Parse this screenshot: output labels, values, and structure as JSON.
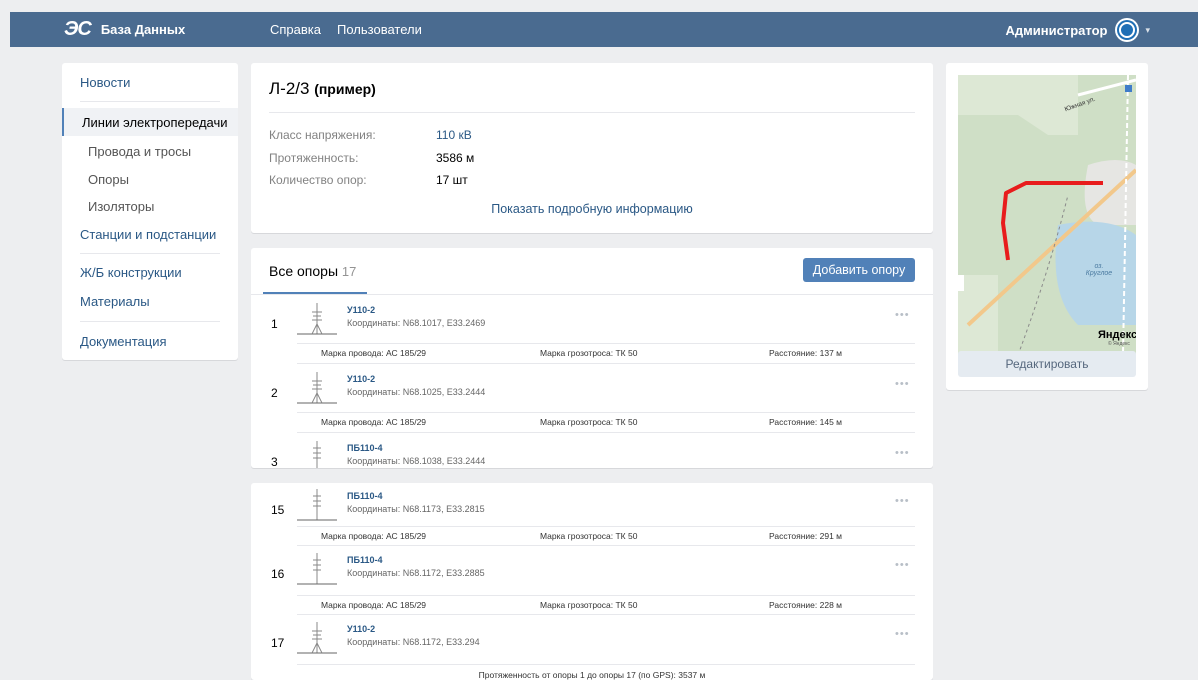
{
  "header": {
    "logo_mark": "ЭС",
    "app_name": "База Данных",
    "nav": [
      "Справка",
      "Пользователи"
    ],
    "user_name": "Администратор"
  },
  "sidebar": {
    "items": [
      {
        "label": "Новости"
      },
      {
        "label": "Линии электропередачи",
        "active": true
      },
      {
        "label": "Провода и тросы"
      },
      {
        "label": "Опоры"
      },
      {
        "label": "Изоляторы"
      },
      {
        "label": "Станции и подстанции"
      },
      {
        "label": "Ж/Б конструкции"
      },
      {
        "label": "Материалы"
      },
      {
        "label": "Документация"
      }
    ]
  },
  "line": {
    "name": "Л-2/3",
    "name_note": "(пример)",
    "props": [
      {
        "label": "Класс напряжения:",
        "value": "110 кВ"
      },
      {
        "label": "Протяженность:",
        "value": "3586 м"
      },
      {
        "label": "Количество опор:",
        "value": "17 шт"
      }
    ],
    "more_link": "Показать подробную информацию"
  },
  "supports": {
    "tab_label": "Все опоры",
    "tab_count": "17",
    "add_button": "Добавить опору",
    "rows": [
      {
        "num": "1",
        "name": "У110-2",
        "coords": "Координаты: N68.1017, E33.2469",
        "wire": "Марка провода: АС 185/29",
        "cable": "Марка грозотроса: ТК 50",
        "distance": "Расстояние: 137 м"
      },
      {
        "num": "2",
        "name": "У110-2",
        "coords": "Координаты: N68.1025, E33.2444",
        "wire": "Марка провода: АС 185/29",
        "cable": "Марка грозотроса: ТК 50",
        "distance": "Расстояние: 145 м"
      },
      {
        "num": "3",
        "name": "ПБ110-4",
        "coords": "Координаты: N68.1038, E33.2444"
      }
    ],
    "rows_end": [
      {
        "num": "15",
        "name": "ПБ110-4",
        "coords": "Координаты: N68.1173, E33.2815",
        "wire": "Марка провода: АС 185/29",
        "cable": "Марка грозотроса: ТК 50",
        "distance": "Расстояние: 291 м"
      },
      {
        "num": "16",
        "name": "ПБ110-4",
        "coords": "Координаты: N68.1172, E33.2885",
        "wire": "Марка провода: АС 185/29",
        "cable": "Марка грозотроса: ТК 50",
        "distance": "Расстояние: 228 м"
      },
      {
        "num": "17",
        "name": "У110-2",
        "coords": "Координаты: N68.1172, E33.294"
      }
    ],
    "footer": "Протяженность от опоры 1 до опоры 17 (по GPS): 3537 м"
  },
  "map": {
    "street_label": "Южная ул.",
    "lake_label": "оз. Круглое",
    "brand": "Яндекс",
    "brand_small": "© Яндекс",
    "route_color": "#e81c1c",
    "edit_button": "Редактировать"
  }
}
